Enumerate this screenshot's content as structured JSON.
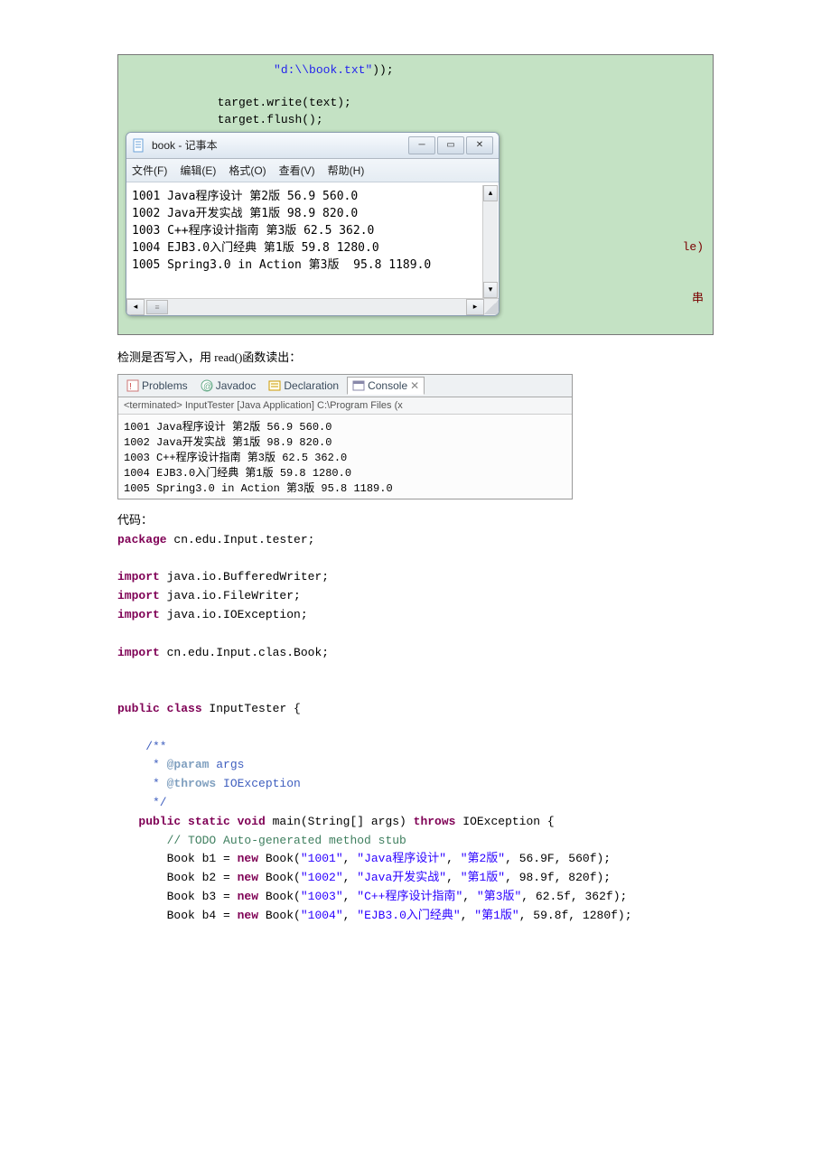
{
  "editor": {
    "path_literal": "\"d:\\\\book.txt\"",
    "close": "));",
    "line_write": "target.write(text);",
    "line_flush": "target.flush();",
    "hint_le": "le)",
    "hint_chuan": "串"
  },
  "notepad": {
    "title": "book - 记事本",
    "menu": {
      "file": "文件(F)",
      "edit": "编辑(E)",
      "format": "格式(O)",
      "view": "查看(V)",
      "help": "帮助(H)"
    },
    "content": "1001 Java程序设计 第2版 56.9 560.0\n1002 Java开发实战 第1版 98.9 820.0\n1003 C++程序设计指南 第3版 62.5 362.0\n1004 EJB3.0入门经典 第1版 59.8 1280.0\n1005 Spring3.0 in Action 第3版  95.8 1189.0"
  },
  "text": {
    "check_desc": "检测是否写入，用 read()函数读出：",
    "code_label": "代码："
  },
  "eclipse": {
    "tabs": {
      "problems": "Problems",
      "javadoc": "Javadoc",
      "declaration": "Declaration",
      "console": "Console"
    },
    "status": "<terminated> InputTester [Java Application] C:\\Program Files (x",
    "output": "1001 Java程序设计 第2版 56.9 560.0\n1002 Java开发实战 第1版 98.9 820.0\n1003 C++程序设计指南 第3版 62.5 362.0\n1004 EJB3.0入门经典 第1版 59.8 1280.0\n1005 Spring3.0 in Action 第3版 95.8 1189.0"
  },
  "java": {
    "pkg": "package",
    "pkg_val": " cn.edu.Input.tester;",
    "imp": "import",
    "imp1": " java.io.BufferedWriter;",
    "imp2": " java.io.FileWriter;",
    "imp3": " java.io.IOException;",
    "imp4": " cn.edu.Input.clas.Book;",
    "cls1": "public class",
    "cls2": " InputTester {",
    "jd1": "    /**",
    "jd2": "     * ",
    "tag_param": "@param",
    "jd_args": " args",
    "tag_throws": "@throws",
    "jd_ioe": " IOException",
    "jd3": "     */",
    "m1": "   public static void",
    "m2": " main(String[] args) ",
    "m_throws": "throws",
    "m3": " IOException {",
    "todo": "       // TODO Auto-generated method stub",
    "b1a": "       Book b1 = ",
    "new": "new",
    "b1b": " Book(",
    "s1001": "\"1001\"",
    "c": ", ",
    "sJava": "\"Java程序设计\"",
    "sV2": "\"第2版\"",
    "b1c": ", 56.9F, 560f);",
    "b2a": "       Book b2 = ",
    "b2b": " Book(",
    "s1002": "\"1002\"",
    "sJavaDev": "\"Java开发实战\"",
    "sV1": "\"第1版\"",
    "b2c": ", 98.9f, 820f);",
    "b3a": "       Book b3 = ",
    "b3b": " Book(",
    "s1003": "\"1003\"",
    "sCpp": "\"C++程序设计指南\"",
    "sV3": "\"第3版\"",
    "b3c": ", 62.5f, 362f);",
    "b4a": "       Book b4 = ",
    "b4b": " Book(",
    "s1004": "\"1004\"",
    "sEjb": "\"EJB3.0入门经典\"",
    "b4c": ", 59.8f, 1280f);"
  }
}
